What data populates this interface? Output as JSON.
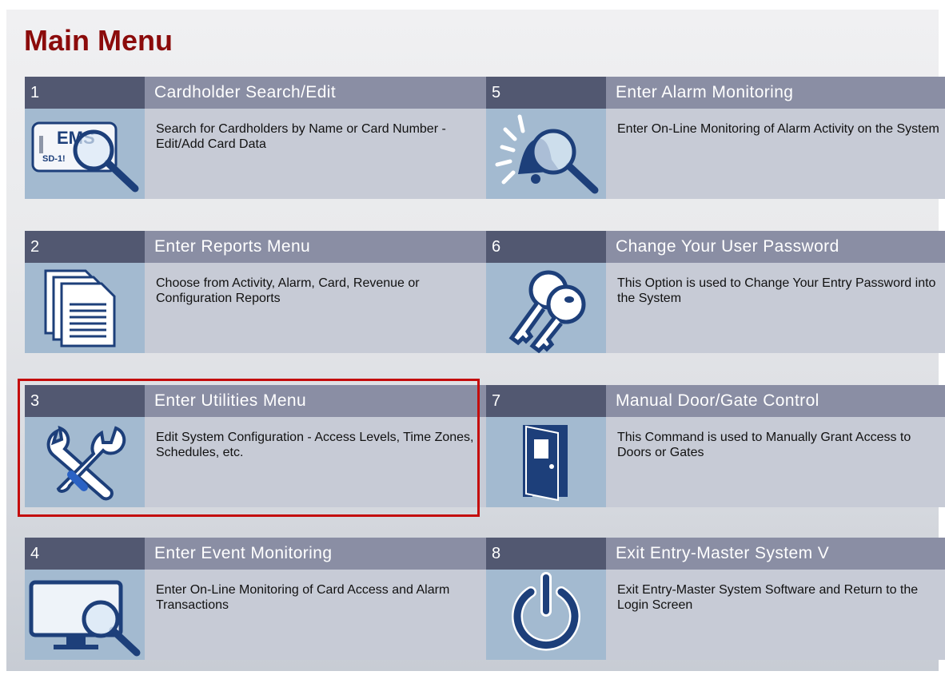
{
  "page": {
    "title": "Main Menu"
  },
  "colors": {
    "title": "#8b0b0b",
    "number_bar": "#525871",
    "label_bar": "#8a8ea4",
    "icon_bg": "#a3bad0",
    "desc_bg": "#c7cbd6",
    "selection": "#c40c0c"
  },
  "menu": {
    "items": [
      {
        "number": "1",
        "label": "Cardholder Search/Edit",
        "description": "Search for Cardholders by Name or Card Number - Edit/Add Card Data",
        "icon": "card-search-icon",
        "icon_text": "EMS",
        "icon_subtext": "SD-1!"
      },
      {
        "number": "2",
        "label": "Enter Reports Menu",
        "description": "Choose from Activity, Alarm, Card, Revenue or Configuration Reports",
        "icon": "reports-icon"
      },
      {
        "number": "3",
        "label": "Enter Utilities Menu",
        "description": "Edit System Configuration - Access Levels, Time Zones, Schedules, etc.",
        "icon": "tools-icon",
        "selected": true
      },
      {
        "number": "4",
        "label": "Enter Event Monitoring",
        "description": "Enter On-Line Monitoring of Card Access and Alarm Transactions",
        "icon": "monitor-search-icon"
      },
      {
        "number": "5",
        "label": "Enter Alarm Monitoring",
        "description": "Enter On-Line Monitoring of Alarm Activity on the System",
        "icon": "alarm-search-icon"
      },
      {
        "number": "6",
        "label": "Change Your User Password",
        "description": "This Option is used to Change Your Entry Password into the System",
        "icon": "keys-icon"
      },
      {
        "number": "7",
        "label": "Manual Door/Gate Control",
        "description": "This Command is used to Manually Grant Access to Doors or Gates",
        "icon": "door-icon"
      },
      {
        "number": "8",
        "label": "Exit Entry-Master System V",
        "description": "Exit Entry-Master System Software and Return to the Login Screen",
        "icon": "power-icon"
      }
    ]
  }
}
